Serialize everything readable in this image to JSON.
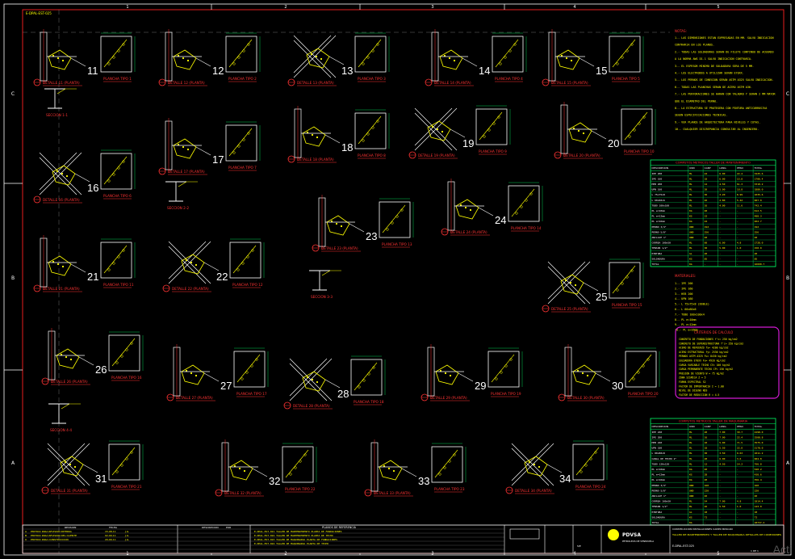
{
  "sheet": {
    "top_left_code": "E-DPAL-EST-025",
    "col_numbers": [
      "1",
      "2",
      "3",
      "4",
      "5"
    ],
    "row_letters": [
      "C",
      "B",
      "A"
    ]
  },
  "details": [
    {
      "number": "11",
      "detail_label": "DETALLE 11 (PLANTA)",
      "plate_label": "PLANCHA TIPO 1"
    },
    {
      "number": "12",
      "detail_label": "DETALLE 12 (PLANTA)",
      "plate_label": "PLANCHA TIPO 2"
    },
    {
      "number": "13",
      "detail_label": "DETALLE 13 (PLANTA)",
      "plate_label": "PLANCHA TIPO 3"
    },
    {
      "number": "14",
      "detail_label": "DETALLE 14 (PLANTA)",
      "plate_label": "PLANCHA TIPO 4"
    },
    {
      "number": "15",
      "detail_label": "DETALLE 15 (PLANTA)",
      "plate_label": "PLANCHA TIPO 5"
    },
    {
      "number": "16",
      "detail_label": "DETALLE 16 (PLANTA)",
      "plate_label": "PLANCHA TIPO 6"
    },
    {
      "number": "17",
      "detail_label": "DETALLE 17 (PLANTA)",
      "plate_label": "PLANCHA TIPO 7"
    },
    {
      "number": "18",
      "detail_label": "DETALLE 18 (PLANTA)",
      "plate_label": "PLANCHA TIPO 8"
    },
    {
      "number": "19",
      "detail_label": "DETALLE 19 (PLANTA)",
      "plate_label": "PLANCHA TIPO 9"
    },
    {
      "number": "20",
      "detail_label": "DETALLE 20 (PLANTA)",
      "plate_label": "PLANCHA TIPO 10"
    },
    {
      "number": "21",
      "detail_label": "DETALLE 21 (PLANTA)",
      "plate_label": "PLANCHA TIPO 11"
    },
    {
      "number": "22",
      "detail_label": "DETALLE 22 (PLANTA)",
      "plate_label": "PLANCHA TIPO 12"
    },
    {
      "number": "23",
      "detail_label": "DETALLE 23 (PLANTA)",
      "plate_label": "PLANCHA TIPO 13"
    },
    {
      "number": "24",
      "detail_label": "DETALLE 24 (PLANTA)",
      "plate_label": "PLANCHA TIPO 14"
    },
    {
      "number": "25",
      "detail_label": "DETALLE 25 (PLANTA)",
      "plate_label": "PLANCHA TIPO 15"
    },
    {
      "number": "26",
      "detail_label": "DETALLE 26 (PLANTA)",
      "plate_label": "PLANCHA TIPO 16"
    },
    {
      "number": "27",
      "detail_label": "DETALLE 27 (PLANTA)",
      "plate_label": "PLANCHA TIPO 17"
    },
    {
      "number": "28",
      "detail_label": "DETALLE 28 (PLANTA)",
      "plate_label": "PLANCHA TIPO 18"
    },
    {
      "number": "29",
      "detail_label": "DETALLE 29 (PLANTA)",
      "plate_label": "PLANCHA TIPO 19"
    },
    {
      "number": "30",
      "detail_label": "DETALLE 30 (PLANTA)",
      "plate_label": "PLANCHA TIPO 20"
    },
    {
      "number": "31",
      "detail_label": "DETALLE 31 (PLANTA)",
      "plate_label": "PLANCHA TIPO 21"
    },
    {
      "number": "32",
      "detail_label": "DETALLE 32 (PLANTA)",
      "plate_label": "PLANCHA TIPO 22"
    },
    {
      "number": "33",
      "detail_label": "DETALLE 33 (PLANTA)",
      "plate_label": "PLANCHA TIPO 23"
    },
    {
      "number": "34",
      "detail_label": "DETALLE 34 (PLANTA)",
      "plate_label": "PLANCHA TIPO 24"
    }
  ],
  "sections": [
    {
      "label": "SECCION 1-1"
    },
    {
      "label": "SECCION 2-2"
    },
    {
      "label": "SECCION 3-3"
    },
    {
      "label": "SECCION 4-4"
    }
  ],
  "notes": {
    "title": "NOTAS:",
    "lines": [
      "1.- LAS DIMENSIONES ESTAN EXPRESADAS EN MM. SALVO INDICACION",
      "    CONTRARIA EN LOS PLANOS.",
      "2.- TODAS LAS SOLDADURAS SERAN DE FILETE CONTINUO DE ACUERDO",
      "    A LA NORMA AWS D1.1 SALVO INDICACION CONTRARIA.",
      "3.- EL ESPESOR MINIMO DE SOLDADURA SERA DE 5 MM.",
      "4.- LOS ELECTRODOS A UTILIZAR SERAN E70XX.",
      "5.- LOS PERNOS DE CONEXION SERAN ASTM A325 SALVO INDICACION.",
      "6.- TODAS LAS PLANCHAS SERAN DE ACERO ASTM A36.",
      "7.- LAS PERFORACIONES SE HARAN CON TALADRO Y SERAN 2 MM MAYOR",
      "    QUE EL DIAMETRO DEL PERNO.",
      "8.- LA ESTRUCTURA SE PROTEGERA CON PINTURA ANTICORROSIVA",
      "    SEGUN ESPECIFICACIONES TECNICAS.",
      "9.- VER PLANOS DE ARQUITECTURA PARA NIVELES Y COTAS.",
      "10.- CUALQUIER DISCREPANCIA CONSULTAR AL INGENIERO."
    ]
  },
  "table1": {
    "title": "COMPUTOS METRICOS TALLER DE MANTENIMIENTO",
    "headers": [
      "DESCRIPCION",
      "UND",
      "CANT",
      "LONG",
      "PESO",
      "TOTAL"
    ],
    "rows": [
      [
        "IPE 200",
        "ML",
        "24",
        "6.00",
        "22.4",
        "3225.6"
      ],
      [
        "IPE 160",
        "ML",
        "18",
        "6.00",
        "15.8",
        "1706.4"
      ],
      [
        "HEB 200",
        "ML",
        "12",
        "4.50",
        "61.3",
        "3310.2"
      ],
      [
        "UPN 160",
        "ML",
        "20",
        "5.00",
        "18.8",
        "1880.0"
      ],
      [
        "L 75x75x8",
        "ML",
        "36",
        "3.20",
        "8.99",
        "1035.6"
      ],
      [
        "L 60x60x6",
        "ML",
        "40",
        "2.80",
        "5.42",
        "607.0"
      ],
      [
        "TUBO 100x100",
        "ML",
        "16",
        "4.00",
        "11.6",
        "742.4"
      ],
      [
        "PL e=10mm",
        "KG",
        "48",
        "-",
        "-",
        "612.5"
      ],
      [
        "PL e=12mm",
        "KG",
        "32",
        "-",
        "-",
        "488.3"
      ],
      [
        "PL e=16mm",
        "KG",
        "24",
        "-",
        "-",
        "402.7"
      ],
      [
        "PERNO 3/4\"",
        "UND",
        "192",
        "-",
        "-",
        "192"
      ],
      [
        "PERNO 5/8\"",
        "UND",
        "256",
        "-",
        "-",
        "256"
      ],
      [
        "ANCLAJE 1\"",
        "UND",
        "48",
        "-",
        "-",
        "48"
      ],
      [
        "CORREA 100x50",
        "ML",
        "60",
        "6.00",
        "4.8",
        "1728.0"
      ],
      [
        "TENSOR 1/2\"",
        "ML",
        "30",
        "5.00",
        "1.0",
        "150.0"
      ],
      [
        "PINTURA",
        "GL",
        "20",
        "-",
        "-",
        "20"
      ],
      [
        "SOLDADURA",
        "KG",
        "85",
        "-",
        "-",
        "85"
      ],
      [
        "TOTAL",
        "KG",
        "-",
        "-",
        "-",
        "16690.7"
      ]
    ]
  },
  "materials": {
    "title": "MATERIALES:",
    "lines": [
      "1.- IPE 200",
      "2.- IPE 160",
      "3.- HEB 200",
      "4.- UPN 160",
      "5.- L 75x75x8 (DOBLE)",
      "6.- L 60x60x6",
      "7.- TUBO 100x100x4",
      "8.- PL e=10mm",
      "9.- PL e=12mm",
      "10.- PL e=16mm"
    ]
  },
  "calc_box": {
    "title": "CRITERIOS DE CALCULO",
    "lines": [
      "CONCRETO DE FUNDACIONES     f'c= 250 kg/cm2",
      "CONCRETO DE SUPERESTRUCTURA f'c= 250 kg/cm2",
      "ACERO DE REFUERZO           fy= 4200 kg/cm2",
      "ACERO ESTRUCTURAL           fy= 2530 kg/cm2",
      "PERNOS ASTM A325            Fu= 8430 kg/cm2",
      "SOLDADURA E70XX             Fu= 4920 kg/cm2",
      "CARGA VARIABLE TECHO        CV= 100 kg/m2",
      "CARGA PERMANENTE TECHO      CP= 150 kg/m2",
      "PRESION DE VIENTO           W = 75 kg/m2",
      "ZONA SISMICA                Z = 5",
      "FORMA ESPECTRAL             S2",
      "FACTOR DE IMPORTANCIA       I = 1.00",
      "NIVEL DE DISENO             ND3",
      "FACTOR DE REDUCCION         R = 4.5"
    ]
  },
  "table2": {
    "title": "COMPUTOS METRICOS TALLER DE MAQUINARIA",
    "headers": [
      "DESCRIPCION",
      "UND",
      "CANT",
      "LONG",
      "PESO",
      "TOTAL"
    ],
    "rows": [
      [
        "IPE 240",
        "ML",
        "20",
        "7.00",
        "30.7",
        "4298.0"
      ],
      [
        "IPE 200",
        "ML",
        "16",
        "7.00",
        "22.4",
        "2508.8"
      ],
      [
        "HEB 220",
        "ML",
        "10",
        "5.00",
        "71.5",
        "3575.0"
      ],
      [
        "UPN 180",
        "ML",
        "18",
        "5.50",
        "22.0",
        "2178.0"
      ],
      [
        "L 80x80x8",
        "ML",
        "30",
        "3.50",
        "9.63",
        "1011.2"
      ],
      [
        "CANAL DE TECHO 2\"",
        "ML",
        "28",
        "6.00",
        "3.6",
        "604.8"
      ],
      [
        "TUBO 120x120",
        "ML",
        "12",
        "4.50",
        "14.2",
        "766.8"
      ],
      [
        "PL e=10mm",
        "KG",
        "40",
        "-",
        "-",
        "540.2"
      ],
      [
        "PL e=12mm",
        "KG",
        "28",
        "-",
        "-",
        "430.6"
      ],
      [
        "PL e=16mm",
        "KG",
        "20",
        "-",
        "-",
        "356.4"
      ],
      [
        "PERNO 3/4\"",
        "UND",
        "160",
        "-",
        "-",
        "160"
      ],
      [
        "PERNO 5/8\"",
        "UND",
        "220",
        "-",
        "-",
        "220"
      ],
      [
        "ANCLAJE 1\"",
        "UND",
        "40",
        "-",
        "-",
        "40"
      ],
      [
        "CORREA 100x50",
        "ML",
        "54",
        "7.00",
        "4.8",
        "1814.4"
      ],
      [
        "TENSOR 1/2\"",
        "ML",
        "26",
        "5.50",
        "1.0",
        "143.0"
      ],
      [
        "PINTURA",
        "GL",
        "18",
        "-",
        "-",
        "18"
      ],
      [
        "SOLDADURA",
        "KG",
        "72",
        "-",
        "-",
        "72"
      ],
      [
        "TOTAL",
        "KG",
        "-",
        "-",
        "-",
        "18737.2"
      ]
    ]
  },
  "title_block": {
    "rev_header": [
      "REVISION",
      "FECHA",
      "DESCRIPCION",
      "POR"
    ],
    "rev_rows": [
      [
        "A",
        "EMITIDO PARA REVISION INTERNA",
        "15-08-11",
        "J.G."
      ],
      [
        "B",
        "EMITIDO PARA REVISION DEL CLIENTE",
        "02-09-11",
        "J.G."
      ],
      [
        "0",
        "EMITIDO PARA CONSTRUCCION",
        "20-09-11",
        "J.G."
      ]
    ],
    "ref_title": "PLANOS DE REFERENCIA",
    "ref_rows": [
      "E-DPAL-EST-021  TALLER DE MANTENIMIENTO PLANTA DE FUNDACIONES",
      "E-DPAL-EST-022  TALLER DE MANTENIMIENTO PLANTA DE TECHO",
      "E-DPAL-EST-023  TALLER DE MAQUINARIA PLANTA DE FUNDACIONES",
      "E-DPAL-EST-024  TALLER DE MAQUINARIA PLANTA DE TECHO"
    ],
    "company": "PDVSA",
    "company_sub": "PETROLEOS DE VENEZUELA",
    "project_title": "CONSTRUCCION INSTALACIONES CAMPO BOSCAN",
    "drawing_title": "TALLER DE MANTENIMIENTO Y TALLER DE MAQUINARIA DETALLES DE CONEXIONES",
    "drawing_no": "E-DPAL-EST-025",
    "scale": "S/E",
    "sheet": "1 DE 1"
  },
  "watermark": "Acti"
}
